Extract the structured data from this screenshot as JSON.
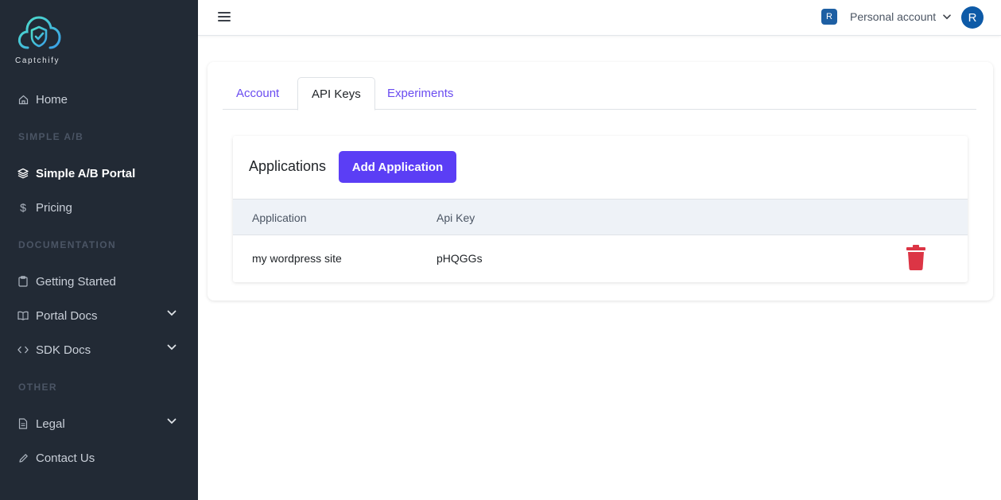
{
  "brand": {
    "name": "Captchify"
  },
  "sidebar": {
    "home": "Home",
    "section_simple": "SIMPLE A/B",
    "portal": "Simple A/B Portal",
    "pricing": "Pricing",
    "section_docs": "DOCUMENTATION",
    "getting_started": "Getting Started",
    "portal_docs": "Portal Docs",
    "sdk_docs": "SDK Docs",
    "section_other": "OTHER",
    "legal": "Legal",
    "contact": "Contact Us"
  },
  "topbar": {
    "badge": "R",
    "account": "Personal account",
    "avatar": "R"
  },
  "tabs": [
    {
      "label": "Account"
    },
    {
      "label": "API Keys"
    },
    {
      "label": "Experiments"
    }
  ],
  "applications": {
    "title": "Applications",
    "add_button": "Add Application",
    "columns": [
      "Application",
      "Api Key"
    ],
    "rows": [
      {
        "application": "my wordpress site",
        "api_key": "pHQGGs"
      }
    ]
  },
  "colors": {
    "sidebar_bg": "#222a35",
    "accent": "#5b3ef5",
    "delete": "#dc3545",
    "avatar": "#0d5aa7"
  }
}
